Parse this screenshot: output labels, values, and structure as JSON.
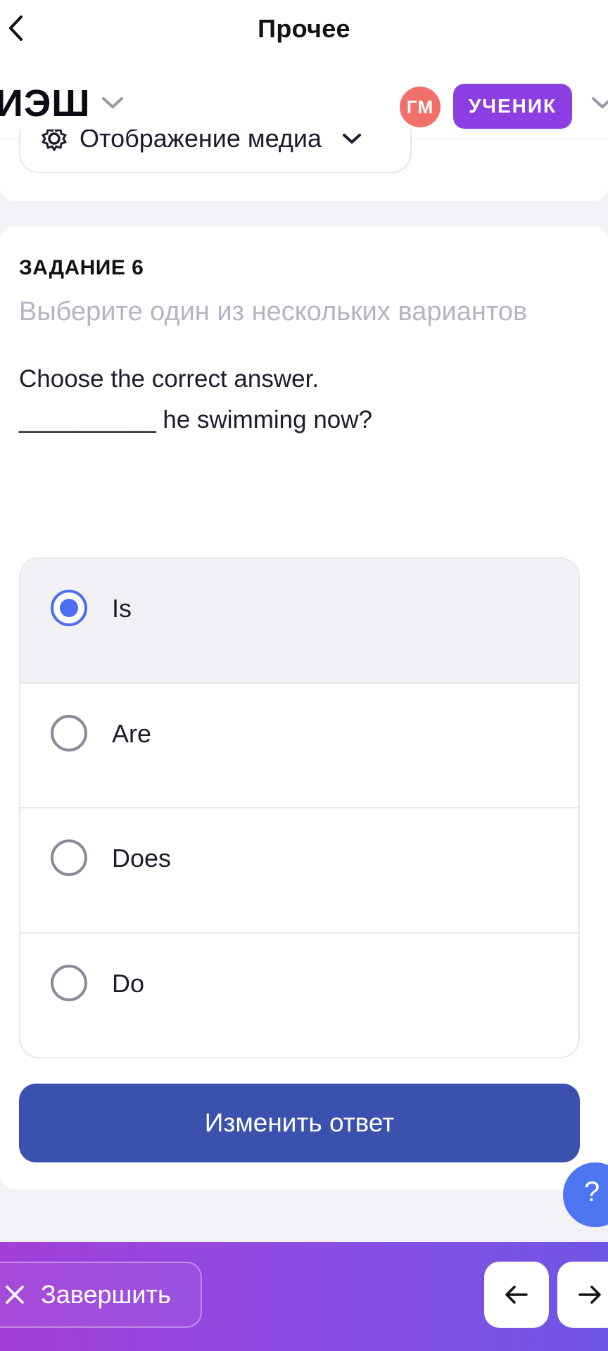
{
  "nav": {
    "title": "Прочее",
    "back_icon": "chevron-left-icon"
  },
  "header": {
    "logo_text": "ИЭШ",
    "avatar_initials": "ГМ",
    "role_label": "УЧЕНИК",
    "colors": {
      "avatar": "#f2706a",
      "role_badge": "#8b3fe2"
    }
  },
  "media_toggle": {
    "label": "Отображение медиа"
  },
  "task": {
    "number_label": "ЗАДАНИЕ 6",
    "instruction": "Выберите один из нескольких вариантов",
    "question_line1": "Choose the correct answer.",
    "question_line2": "__________ he swimming now?",
    "options": [
      {
        "label": "Is",
        "selected": true
      },
      {
        "label": "Are",
        "selected": false
      },
      {
        "label": "Does",
        "selected": false
      },
      {
        "label": "Do",
        "selected": false
      }
    ],
    "change_button_label": "Изменить ответ"
  },
  "help": {
    "label": "?"
  },
  "footer": {
    "finish_label": "Завершить",
    "prev_icon": "arrow-left-icon",
    "next_icon": "arrow-right-icon"
  },
  "colors": {
    "accent": "#4d6ef0",
    "primary_button": "#3a51ad",
    "footer_gradient_start": "#a23fd8",
    "footer_gradient_end": "#6f56e6"
  }
}
